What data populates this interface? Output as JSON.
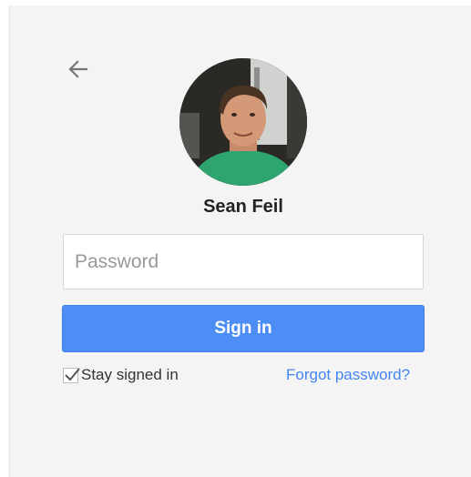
{
  "back_icon": "arrow-left-icon",
  "user": {
    "name": "Sean Feil",
    "avatar": "user-avatar-photo"
  },
  "password": {
    "placeholder": "Password",
    "value": ""
  },
  "signin_button": {
    "label": "Sign in",
    "color": "#4d8ef6"
  },
  "stay_signed_in": {
    "label": "Stay signed in",
    "checked": true
  },
  "forgot_password": {
    "label": "Forgot password?",
    "color": "#4285f4"
  }
}
